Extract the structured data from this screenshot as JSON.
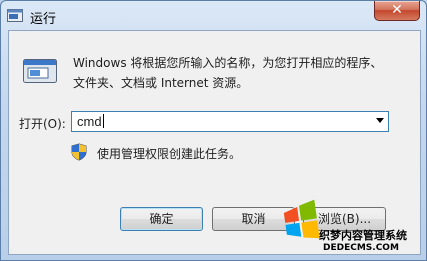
{
  "window": {
    "title": "运行",
    "close_label": "✕"
  },
  "description": {
    "line1": "Windows 将根据您所输入的名称，为您打开相应的程序、",
    "line2": "文件夹、文档或 Internet 资源。"
  },
  "open_field": {
    "label": "打开(O):",
    "value": "cmd"
  },
  "admin_note": "使用管理权限创建此任务。",
  "buttons": {
    "ok": "确定",
    "cancel": "取消",
    "browse": "浏览(B)..."
  },
  "watermark": {
    "line1": "织梦内容管理系统",
    "line2": "DEDECMS.COM"
  },
  "colors": {
    "title_bar": "#c4d7ee",
    "close_button": "#c3472c",
    "input_border": "#3c7fb1"
  },
  "icons": [
    "run-icon",
    "shield-icon",
    "close-icon",
    "dropdown-arrow-icon",
    "windows-logo-icon"
  ]
}
